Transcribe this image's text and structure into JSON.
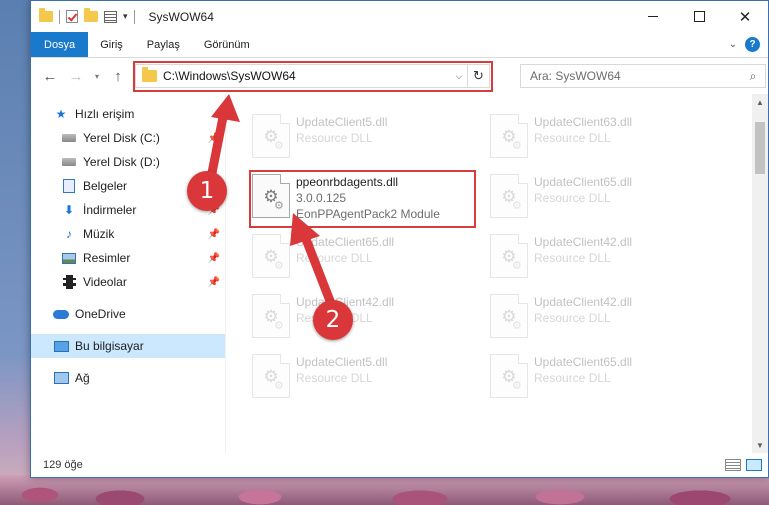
{
  "window": {
    "title": "SysWOW64",
    "controls": {
      "minimize": "",
      "maximize": "",
      "close": "✕"
    }
  },
  "ribbon": {
    "tabs": [
      "Dosya",
      "Giriş",
      "Paylaş",
      "Görünüm"
    ],
    "help": "?"
  },
  "navbar": {
    "address": "C:\\Windows\\SysWOW64",
    "search_placeholder": "Ara: SysWOW64"
  },
  "sidebar": {
    "items": [
      {
        "label": "Hızlı erişim",
        "icon": "star-icon",
        "pinned": false
      },
      {
        "label": "Yerel Disk (C:)",
        "icon": "drive-icon",
        "pinned": true
      },
      {
        "label": "Yerel Disk (D:)",
        "icon": "drive-icon",
        "pinned": true
      },
      {
        "label": "Belgeler",
        "icon": "documents-icon",
        "pinned": true
      },
      {
        "label": "İndirmeler",
        "icon": "downloads-icon",
        "pinned": true
      },
      {
        "label": "Müzik",
        "icon": "music-icon",
        "pinned": true
      },
      {
        "label": "Resimler",
        "icon": "pictures-icon",
        "pinned": true
      },
      {
        "label": "Videolar",
        "icon": "videos-icon",
        "pinned": true
      },
      {
        "label": "OneDrive",
        "icon": "onedrive-icon",
        "pinned": false
      },
      {
        "label": "Bu bilgisayar",
        "icon": "this-pc-icon",
        "pinned": false,
        "selected": true
      },
      {
        "label": "Ağ",
        "icon": "network-icon",
        "pinned": false
      }
    ]
  },
  "files": {
    "highlighted": {
      "name": "ppeonrbdagents.dll",
      "version": "3.0.0.125",
      "description": "EonPPAgentPack2 Module"
    },
    "left_column": [
      {
        "name": "UpdateClient5.dll",
        "type": "Resource DLL"
      },
      {
        "name": "UpdateClient65.dll",
        "type": "Resource DLL"
      },
      {
        "name": "UpdateClient42.dll",
        "type": "Resource DLL"
      },
      {
        "name": "UpdateClient5.dll",
        "type": "Resource DLL"
      }
    ],
    "right_column": [
      {
        "name": "UpdateClient63.dll",
        "type": "Resource DLL"
      },
      {
        "name": "UpdateClient65.dll",
        "type": "Resource DLL"
      },
      {
        "name": "UpdateClient42.dll",
        "type": "Resource DLL"
      },
      {
        "name": "UpdateClient42.dll",
        "type": "Resource DLL"
      },
      {
        "name": "UpdateClient65.dll",
        "type": "Resource DLL"
      }
    ]
  },
  "statusbar": {
    "item_count": "129 öğe"
  },
  "annotations": {
    "step1": "1",
    "step2": "2",
    "color": "#d9373a"
  }
}
